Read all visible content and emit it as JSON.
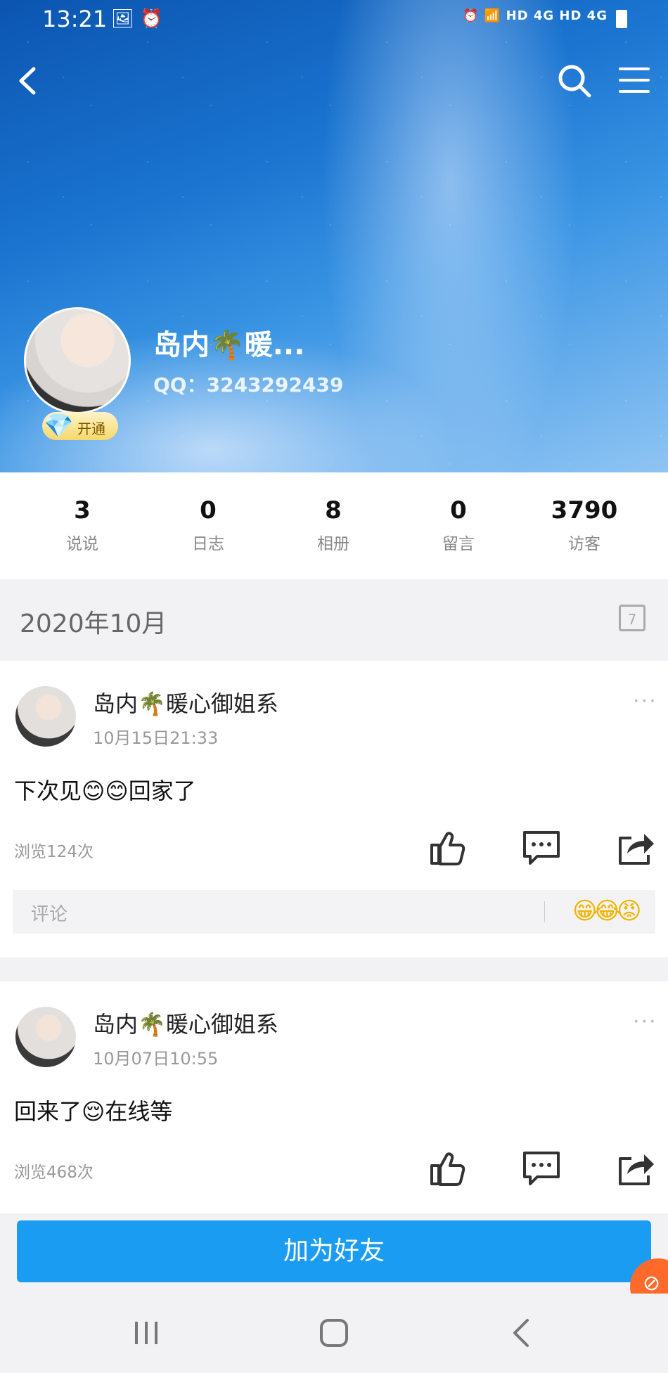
{
  "status_bar": {
    "time": "13:21",
    "left_icons": "🖼 ⏰",
    "right_icons": "⏰ 📶 HD 4G HD 4G"
  },
  "header": {
    "back_icon": "back-arrow-icon",
    "search_icon": "search-icon",
    "menu_icon": "hamburger-menu-icon"
  },
  "profile": {
    "name": "岛内🌴暖...",
    "qq": "QQ：3243292439",
    "vip_badge": "开通",
    "vip_gem": "💎"
  },
  "stats": [
    {
      "value": "3",
      "label": "说说"
    },
    {
      "value": "0",
      "label": "日志"
    },
    {
      "value": "8",
      "label": "相册"
    },
    {
      "value": "0",
      "label": "留言"
    },
    {
      "value": "3790",
      "label": "访客"
    }
  ],
  "month_header": {
    "label": "2020年10月",
    "calendar_day": "7"
  },
  "posts": [
    {
      "author": "岛内🌴暖心御姐系",
      "time": "10月15日21:33",
      "text": "下次见😊😊回家了",
      "views": "浏览124次",
      "more": "···",
      "comment_placeholder": "评论",
      "comment_emojis": "😁😂😡"
    },
    {
      "author": "岛内🌴暖心御姐系",
      "time": "10月07日10:55",
      "text": "回来了😌在线等",
      "views": "浏览468次",
      "more": "···"
    }
  ],
  "add_friend_button": "加为好友",
  "colors": {
    "accent": "#1a9cf2",
    "fab": "#ff6a2b",
    "vip_gold": "#f5b400"
  }
}
